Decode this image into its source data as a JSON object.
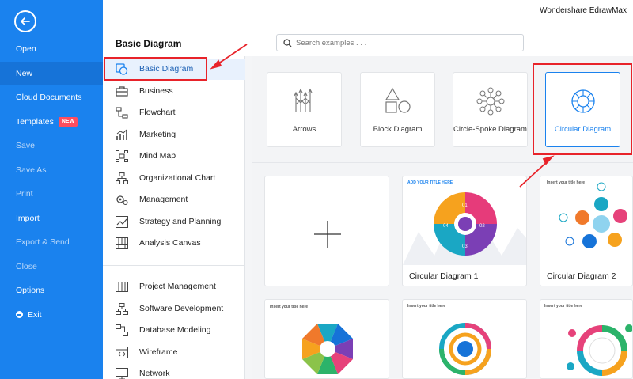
{
  "app": {
    "title": "Wondershare EdrawMax"
  },
  "left_menu": {
    "items": [
      {
        "label": "Open"
      },
      {
        "label": "New"
      },
      {
        "label": "Cloud Documents"
      },
      {
        "label": "Templates",
        "badge": "NEW"
      },
      {
        "label": "Save"
      },
      {
        "label": "Save As"
      },
      {
        "label": "Print"
      },
      {
        "label": "Import"
      },
      {
        "label": "Export & Send"
      },
      {
        "label": "Close"
      },
      {
        "label": "Options"
      },
      {
        "label": "Exit"
      }
    ],
    "active": "New"
  },
  "section_title": "Basic Diagram",
  "search": {
    "placeholder": "Search examples . . ."
  },
  "categories": {
    "items": [
      {
        "label": "Basic Diagram"
      },
      {
        "label": "Business"
      },
      {
        "label": "Flowchart"
      },
      {
        "label": "Marketing"
      },
      {
        "label": "Mind Map"
      },
      {
        "label": "Organizational Chart"
      },
      {
        "label": "Management"
      },
      {
        "label": "Strategy and Planning"
      },
      {
        "label": "Analysis Canvas"
      },
      {
        "label": "Project Management"
      },
      {
        "label": "Software Development"
      },
      {
        "label": "Database Modeling"
      },
      {
        "label": "Wireframe"
      },
      {
        "label": "Network"
      }
    ],
    "active": "Basic Diagram"
  },
  "diagram_types": [
    {
      "label": "Arrows"
    },
    {
      "label": "Block Diagram"
    },
    {
      "label": "Circle-Spoke Diagram"
    },
    {
      "label": "Circular Diagram",
      "selected": true
    }
  ],
  "templates": [
    {
      "label": ""
    },
    {
      "label": "Circular Diagram 1",
      "thumb_title": "ADD YOUR TITLE HERE",
      "segments": [
        "01",
        "02",
        "03",
        "04"
      ]
    },
    {
      "label": "Circular Diagram 2",
      "thumb_title": "Insert your title here"
    },
    {
      "label": "",
      "thumb_title": "Insert your title here"
    },
    {
      "label": "",
      "thumb_title": "Insert your title here"
    },
    {
      "label": "",
      "thumb_title": "Insert your title here"
    }
  ],
  "colors": {
    "primary": "#1a82ee",
    "highlight": "#e8232a",
    "badge": "#ff4d5e"
  }
}
